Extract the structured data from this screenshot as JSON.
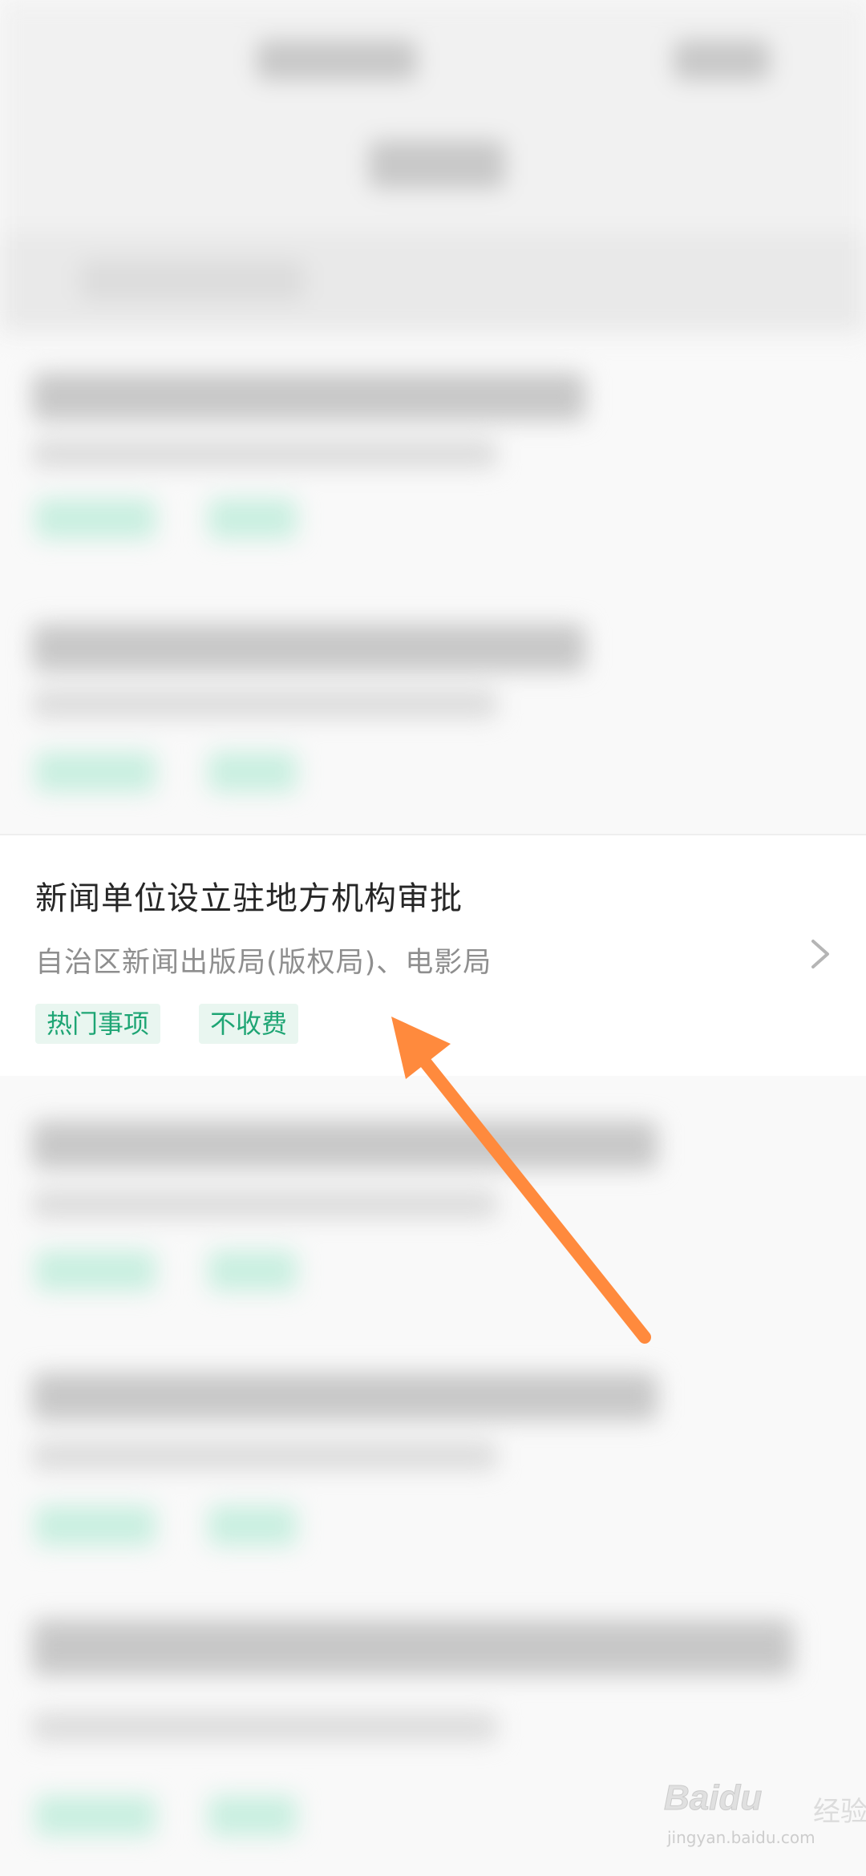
{
  "focused_item": {
    "title": "新闻单位设立驻地方机构审批",
    "department": "自治区新闻出版局(版权局)、电影局",
    "tags": [
      "热门事项",
      "不收费"
    ]
  },
  "watermark": {
    "logo": "Baidu",
    "suffix": "经验",
    "url": "jingyan.baidu.com"
  },
  "colors": {
    "tag_text": "#1ea574",
    "tag_bg": "#e9f6f0",
    "arrow": "#ff8a3d"
  }
}
